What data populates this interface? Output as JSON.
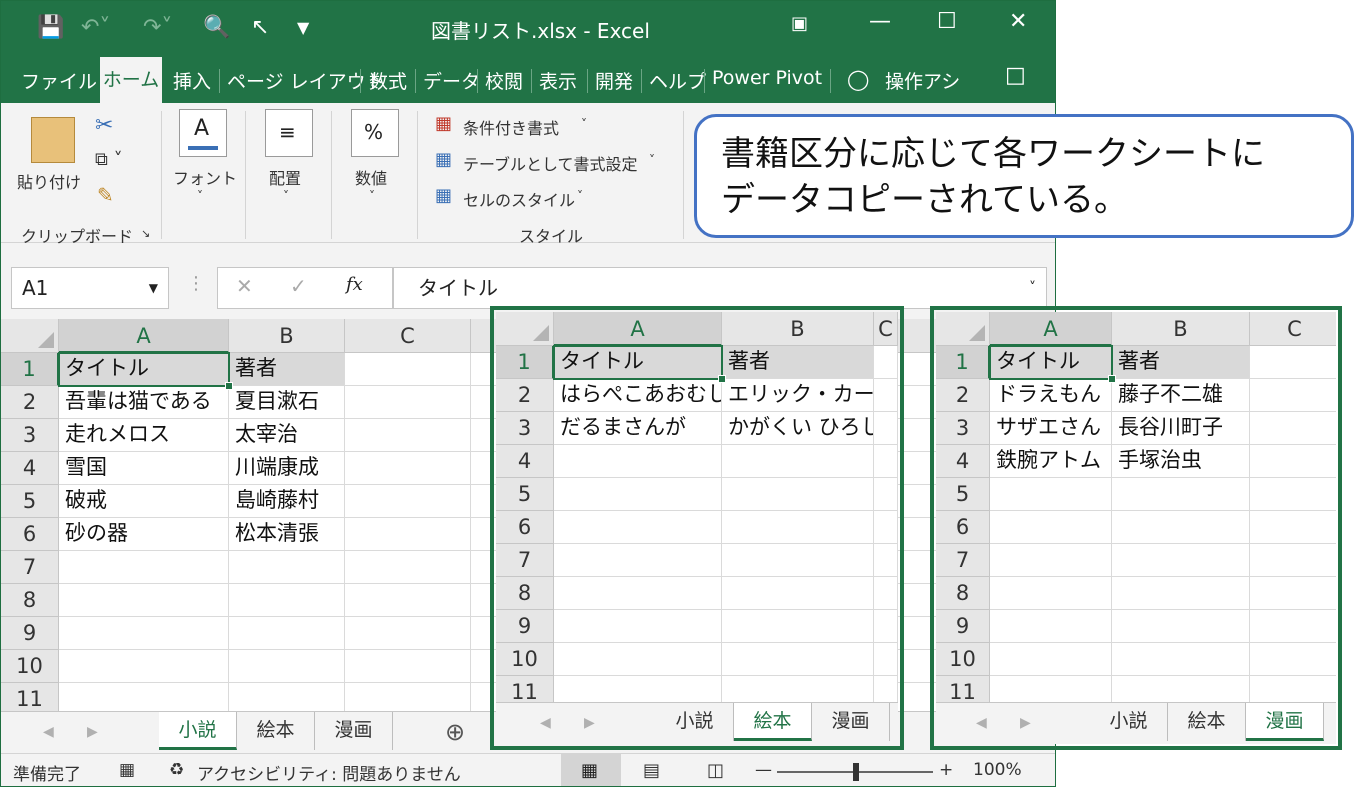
{
  "window": {
    "title": "図書リスト.xlsx  -  Excel"
  },
  "menu": [
    "ファイル",
    "ホーム",
    "挿入",
    "ページ レイアウト",
    "数式",
    "データ",
    "校閲",
    "表示",
    "開発",
    "ヘルプ",
    "Power Pivot",
    "操作アシ"
  ],
  "ribbon": {
    "paste": "貼り付け",
    "clipboard": "クリップボード",
    "font": "フォント",
    "align": "配置",
    "number": "数値",
    "cond_format": "条件付き書式",
    "table_format": "テーブルとして書式設定",
    "cell_style": "セルのスタイル",
    "style": "スタイル"
  },
  "formula_bar": {
    "name_box": "A1",
    "formula": "タイトル"
  },
  "status": {
    "ready": "準備完了",
    "accessibility": "アクセシビリティ: 問題ありません",
    "zoom": "100%"
  },
  "callout": {
    "line1": "書籍区分に応じて各ワークシートに",
    "line2": "データコピーされている。"
  },
  "sheets": {
    "novel": {
      "rows": [
        [
          "タイトル",
          "著者"
        ],
        [
          "吾輩は猫である",
          "夏目漱石"
        ],
        [
          "走れメロス",
          "太宰治"
        ],
        [
          "雪国",
          "川端康成"
        ],
        [
          "破戒",
          "島崎藤村"
        ],
        [
          "砂の器",
          "松本清張"
        ]
      ],
      "tabs": [
        "小説",
        "絵本",
        "漫画"
      ],
      "active_tab": 0
    },
    "picture_book": {
      "rows": [
        [
          "タイトル",
          "著者"
        ],
        [
          "はらぺこあおむし",
          "エリック・カール"
        ],
        [
          "だるまさんが",
          "かがくい ひろし"
        ]
      ],
      "tabs": [
        "小説",
        "絵本",
        "漫画"
      ],
      "active_tab": 1
    },
    "manga": {
      "rows": [
        [
          "タイトル",
          "著者"
        ],
        [
          "ドラえもん",
          "藤子不二雄"
        ],
        [
          "サザエさん",
          "長谷川町子"
        ],
        [
          "鉄腕アトム",
          "手塚治虫"
        ]
      ],
      "tabs": [
        "小説",
        "絵本",
        "漫画"
      ],
      "active_tab": 2
    }
  },
  "columns": [
    "A",
    "B",
    "C"
  ],
  "row_numbers": [
    "1",
    "2",
    "3",
    "4",
    "5",
    "6",
    "7",
    "8",
    "9",
    "10",
    "11"
  ],
  "colors": {
    "excel_green": "#217346",
    "callout_border": "#4472c4"
  }
}
